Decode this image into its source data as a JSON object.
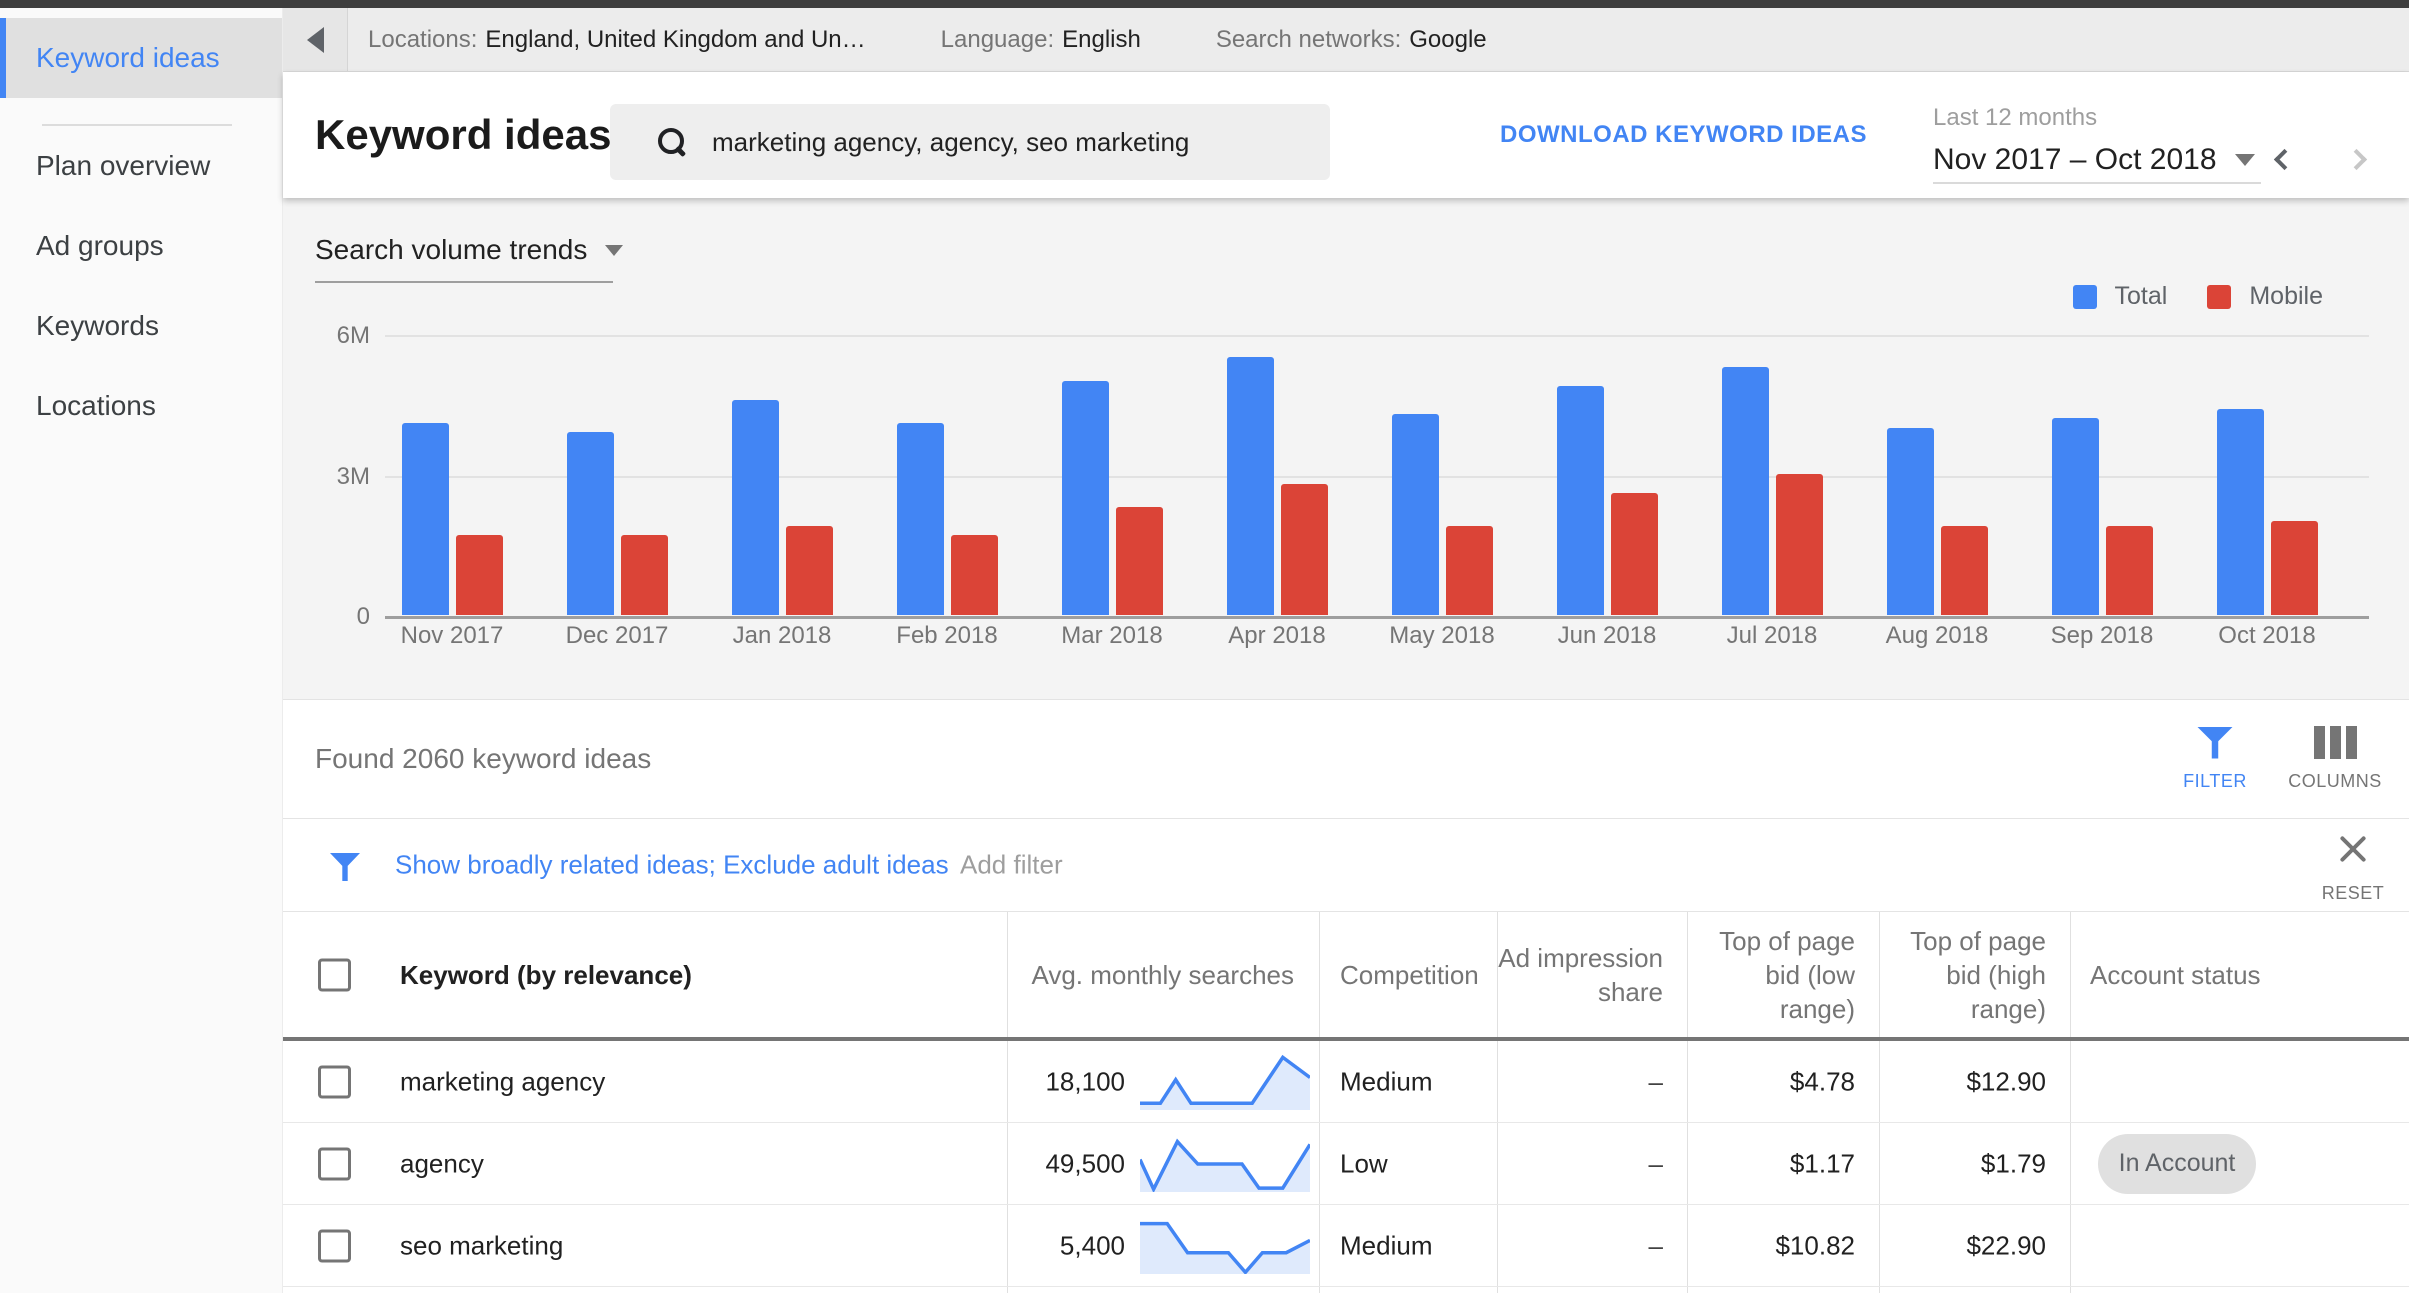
{
  "topbar": {
    "locations_label": "Locations:",
    "locations_value": "England, United Kingdom and Un…",
    "language_label": "Language:",
    "language_value": "English",
    "networks_label": "Search networks:",
    "networks_value": "Google"
  },
  "sidebar": {
    "active": "Keyword ideas",
    "items": [
      "Plan overview",
      "Ad groups",
      "Keywords",
      "Locations"
    ]
  },
  "header": {
    "title": "Keyword ideas",
    "search_value": "marketing agency, agency, seo marketing",
    "download_label": "DOWNLOAD KEYWORD IDEAS",
    "range_caption": "Last 12 months",
    "range_value": "Nov 2017 – Oct 2018"
  },
  "chart_data": {
    "type": "bar",
    "title": "Search volume trends",
    "unit": "millions of monthly searches",
    "categories": [
      "Nov 2017",
      "Dec 2017",
      "Jan 2018",
      "Feb 2018",
      "Mar 2018",
      "Apr 2018",
      "May 2018",
      "Jun 2018",
      "Jul 2018",
      "Aug 2018",
      "Sep 2018",
      "Oct 2018"
    ],
    "series": [
      {
        "name": "Total",
        "color": "#4285f4",
        "values": [
          4.1,
          3.9,
          4.6,
          4.1,
          5.0,
          5.5,
          4.3,
          4.9,
          5.3,
          4.0,
          4.2,
          4.4
        ]
      },
      {
        "name": "Mobile",
        "color": "#db4437",
        "values": [
          1.7,
          1.7,
          1.9,
          1.7,
          2.3,
          2.8,
          1.9,
          2.6,
          3.0,
          1.9,
          1.9,
          2.0
        ]
      }
    ],
    "ylim": [
      0,
      6
    ],
    "yticks": [
      "6M",
      "3M",
      "0"
    ],
    "grid": true,
    "legend_position": "top-right"
  },
  "results": {
    "found_text": "Found 2060 keyword ideas",
    "filter_label": "FILTER",
    "columns_label": "COLUMNS",
    "filter_link": "Show broadly related ideas; Exclude adult ideas",
    "add_filter": "Add filter",
    "reset_label": "RESET"
  },
  "table": {
    "headers": {
      "keyword": "Keyword (by relevance)",
      "avg": "Avg. monthly searches",
      "competition": "Competition",
      "ad_impression_share": "Ad impression share",
      "top_low": "Top of page bid (low range)",
      "top_high": "Top of page bid (high range)",
      "account_status": "Account status"
    },
    "rows": [
      {
        "keyword": "marketing agency",
        "avg": "18,100",
        "competition": "Medium",
        "ad_impression_share": "–",
        "top_low": "$4.78",
        "top_high": "$12.90",
        "account_status": "",
        "sparkline": [
          [
            0,
            88
          ],
          [
            12,
            88
          ],
          [
            21,
            46
          ],
          [
            30,
            88
          ],
          [
            66,
            88
          ],
          [
            84,
            6
          ],
          [
            100,
            42
          ]
        ]
      },
      {
        "keyword": "agency",
        "avg": "49,500",
        "competition": "Low",
        "ad_impression_share": "–",
        "top_low": "$1.17",
        "top_high": "$1.79",
        "account_status": "In Account",
        "sparkline": [
          [
            0,
            42
          ],
          [
            8,
            95
          ],
          [
            22,
            10
          ],
          [
            34,
            50
          ],
          [
            60,
            50
          ],
          [
            70,
            93
          ],
          [
            84,
            93
          ],
          [
            100,
            15
          ]
        ]
      },
      {
        "keyword": "seo marketing",
        "avg": "5,400",
        "competition": "Medium",
        "ad_impression_share": "–",
        "top_low": "$10.82",
        "top_high": "$22.90",
        "account_status": "",
        "sparkline": [
          [
            0,
            10
          ],
          [
            16,
            10
          ],
          [
            28,
            62
          ],
          [
            52,
            62
          ],
          [
            62,
            97
          ],
          [
            72,
            62
          ],
          [
            86,
            62
          ],
          [
            100,
            40
          ]
        ]
      }
    ]
  }
}
